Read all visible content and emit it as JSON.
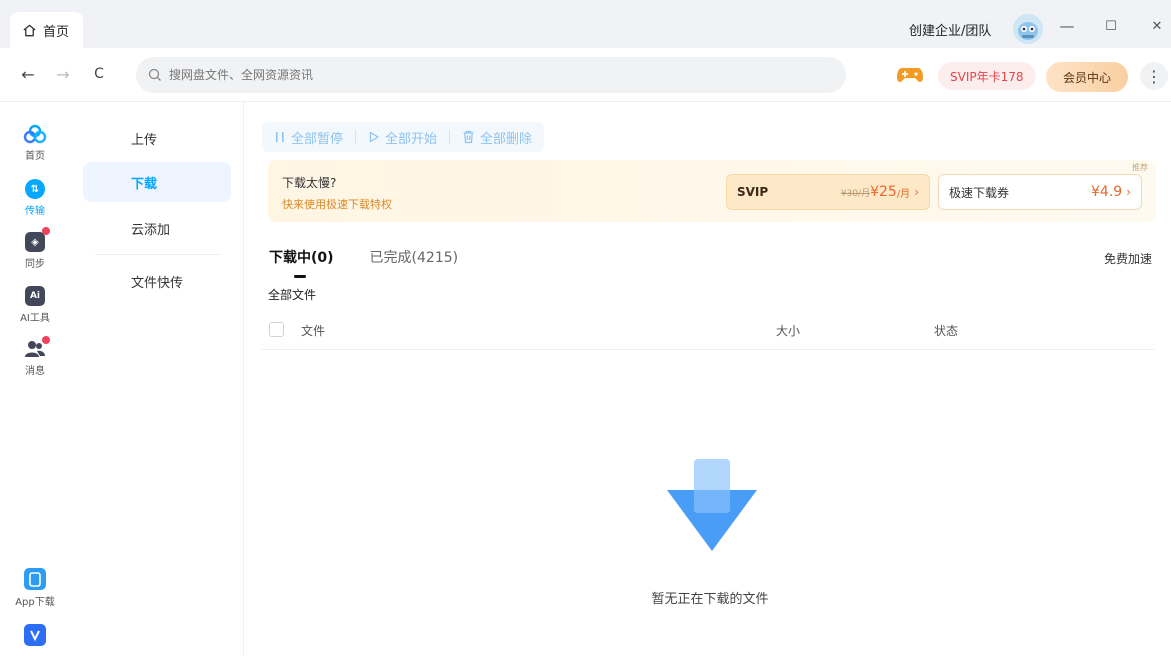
{
  "titlebar": {
    "home_tab": "首页",
    "create_team": "创建企业/团队",
    "minimize": "—",
    "maximize": "☐",
    "close": "✕"
  },
  "navbar": {
    "back": "←",
    "forward": "→",
    "refresh": "C",
    "search_placeholder": "搜网盘文件、全网资源资讯",
    "svip_badge": "SVIP年卡178",
    "member_center": "会员中心",
    "more": "⋮"
  },
  "iconbar": {
    "items": [
      {
        "label": "首页",
        "icon": "cloud-logo-icon"
      },
      {
        "label": "传输",
        "icon": "transfer-icon",
        "glyph": "⇅"
      },
      {
        "label": "同步",
        "icon": "sync-icon",
        "glyph": "◈"
      },
      {
        "label": "AI工具",
        "icon": "ai-tools-icon",
        "glyph": "Ai"
      },
      {
        "label": "消息",
        "icon": "message-icon"
      }
    ],
    "bottom": [
      {
        "label": "App下载",
        "icon": "app-download-icon"
      }
    ]
  },
  "subbar": {
    "items": [
      {
        "label": "上传"
      },
      {
        "label": "下载"
      },
      {
        "label": "云添加"
      },
      {
        "label": "文件快传"
      }
    ]
  },
  "toolbar": {
    "pause_all": "全部暂停",
    "start_all": "全部开始",
    "delete_all": "全部删除"
  },
  "banner": {
    "title": "下载太慢?",
    "subtitle": "快来使用极速下载特权",
    "tag": "推荐",
    "svip_name": "SVIP",
    "svip_old_price": "¥30/月",
    "svip_price": "¥25",
    "svip_unit": "/月",
    "ticket_name": "极速下载券",
    "ticket_price": "¥4.9"
  },
  "tabs": {
    "downloading": "下载中(0)",
    "completed": "已完成(4215)"
  },
  "free_speed": "免费加速",
  "all_files": "全部文件",
  "table": {
    "col_file": "文件",
    "col_size": "大小",
    "col_status": "状态"
  },
  "empty_text": "暂无正在下载的文件",
  "colors": {
    "accent": "#06a7ff",
    "badge_red": "#f2415a",
    "price_orange": "#e9682a"
  }
}
